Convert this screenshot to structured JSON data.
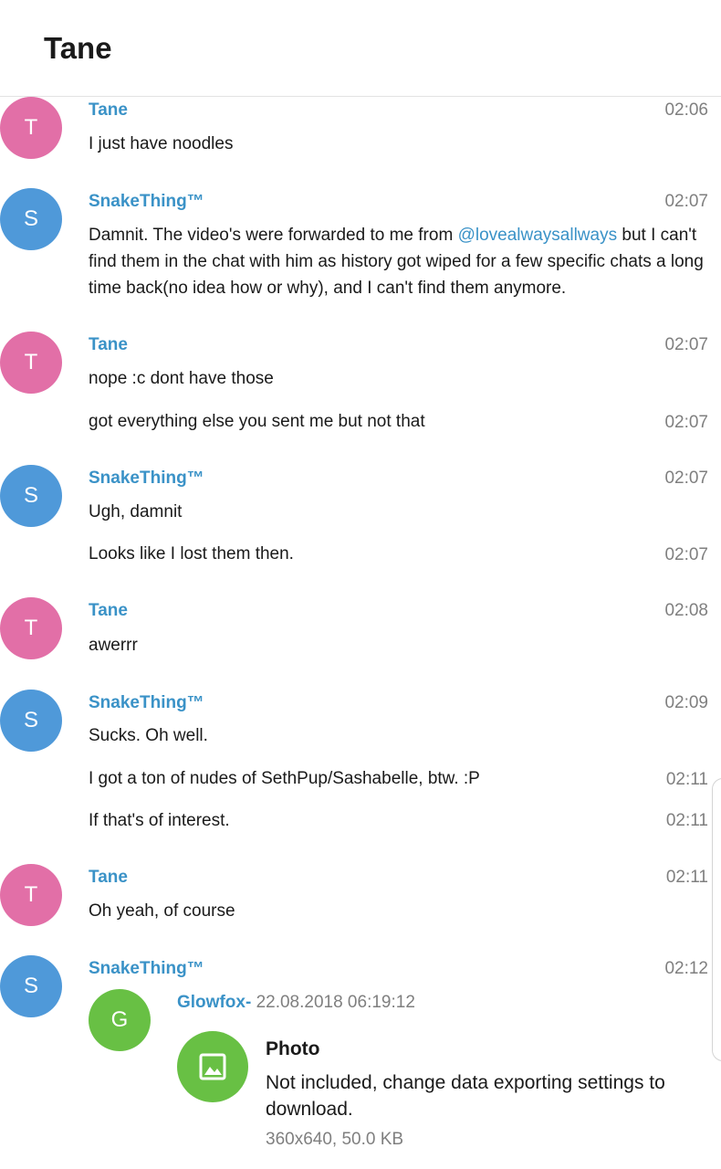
{
  "header": {
    "title": "Tane"
  },
  "icons": {
    "photo": "image-icon"
  },
  "colors": {
    "tane_avatar": "#e26fa7",
    "snake_avatar": "#4f99d9",
    "glowfox_avatar": "#68c044",
    "name_link": "#3a92c7"
  },
  "messages": [
    {
      "avatar": "T",
      "sender": "Tane",
      "time": "02:06",
      "text": "I just have noodles"
    },
    {
      "avatar": "S",
      "sender": "SnakeThing™",
      "time": "02:07",
      "text_before": "Damnit. The video's were forwarded to me from ",
      "mention": "@lovealwaysallways",
      "text_after": " but I can't find them in the chat with him as history got wiped for a few specific chats a long time back(no idea how or why), and I can't find them anymore."
    },
    {
      "avatar": "T",
      "sender": "Tane",
      "time": "02:07",
      "text": "nope :c dont have those"
    },
    {
      "time": "02:07",
      "text": "got everything else you sent me but not that"
    },
    {
      "avatar": "S",
      "sender": "SnakeThing™",
      "time": "02:07",
      "text": "Ugh, damnit"
    },
    {
      "time": "02:07",
      "text": "Looks like I lost them then."
    },
    {
      "avatar": "T",
      "sender": "Tane",
      "time": "02:08",
      "text": "awerrr"
    },
    {
      "avatar": "S",
      "sender": "SnakeThing™",
      "time": "02:09",
      "text": "Sucks. Oh well."
    },
    {
      "time": "02:11",
      "text": "I got a ton of nudes of SethPup/Sashabelle, btw. :P"
    },
    {
      "time": "02:11",
      "text": "If that's of interest."
    },
    {
      "avatar": "T",
      "sender": "Tane",
      "time": "02:11",
      "text": "Oh yeah, of course"
    },
    {
      "avatar": "S",
      "sender": "SnakeThing™",
      "time": "02:12"
    }
  ],
  "forward": {
    "avatar": "G",
    "from": "Glowfox-",
    "date": "22.08.2018 06:19:12",
    "photo_title": "Photo",
    "photo_desc": "Not included, change data exporting settings to download.",
    "photo_meta": "360x640, 50.0 KB"
  }
}
